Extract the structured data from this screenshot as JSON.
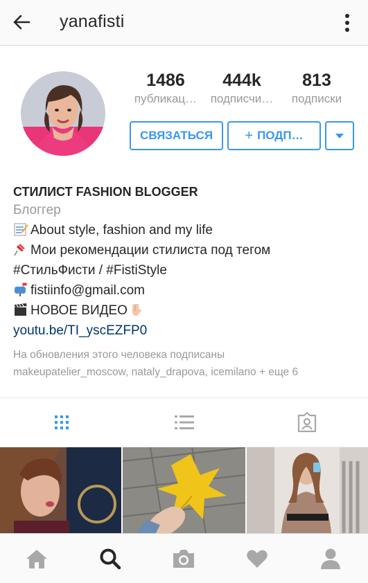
{
  "header": {
    "username": "yanafisti",
    "back_icon": "arrow-left-icon",
    "more_icon": "more-vertical-icon"
  },
  "stats": [
    {
      "value": "1486",
      "label": "публикац…"
    },
    {
      "value": "444k",
      "label": "подписчи…"
    },
    {
      "value": "813",
      "label": "подписки"
    }
  ],
  "actions": {
    "contact_label": "СВЯЗАТЬСЯ",
    "follow_label": "ПОДП…",
    "follow_icon": "plus-icon",
    "dropdown_icon": "caret-down-icon"
  },
  "bio": {
    "name": "СТИЛИСТ FASHION BLOGGER",
    "category": "Блоггер",
    "line1": "About style, fashion and my life",
    "line2": "Мои рекомендации стилиста под тегом",
    "line3": "#СтильФисти / #FistiStyle",
    "email": "fistiinfo@gmail.com",
    "line5": "НОВОЕ ВИДЕО",
    "link": "youtu.be/TI_yscEZFP0",
    "followed_line1": "На обновления этого человека подписаны",
    "followed_line2": "makeupatelier_moscow, nataly_drapova, icemilano + еще 6"
  },
  "tabs": [
    "grid-view-icon",
    "list-view-icon",
    "tagged-photos-icon"
  ],
  "bottom_nav": [
    "home-icon",
    "search-icon",
    "camera-icon",
    "heart-icon",
    "profile-icon"
  ],
  "colors": {
    "accent": "#3897f0",
    "link": "#003569",
    "muted": "#999999",
    "text": "#262626"
  }
}
